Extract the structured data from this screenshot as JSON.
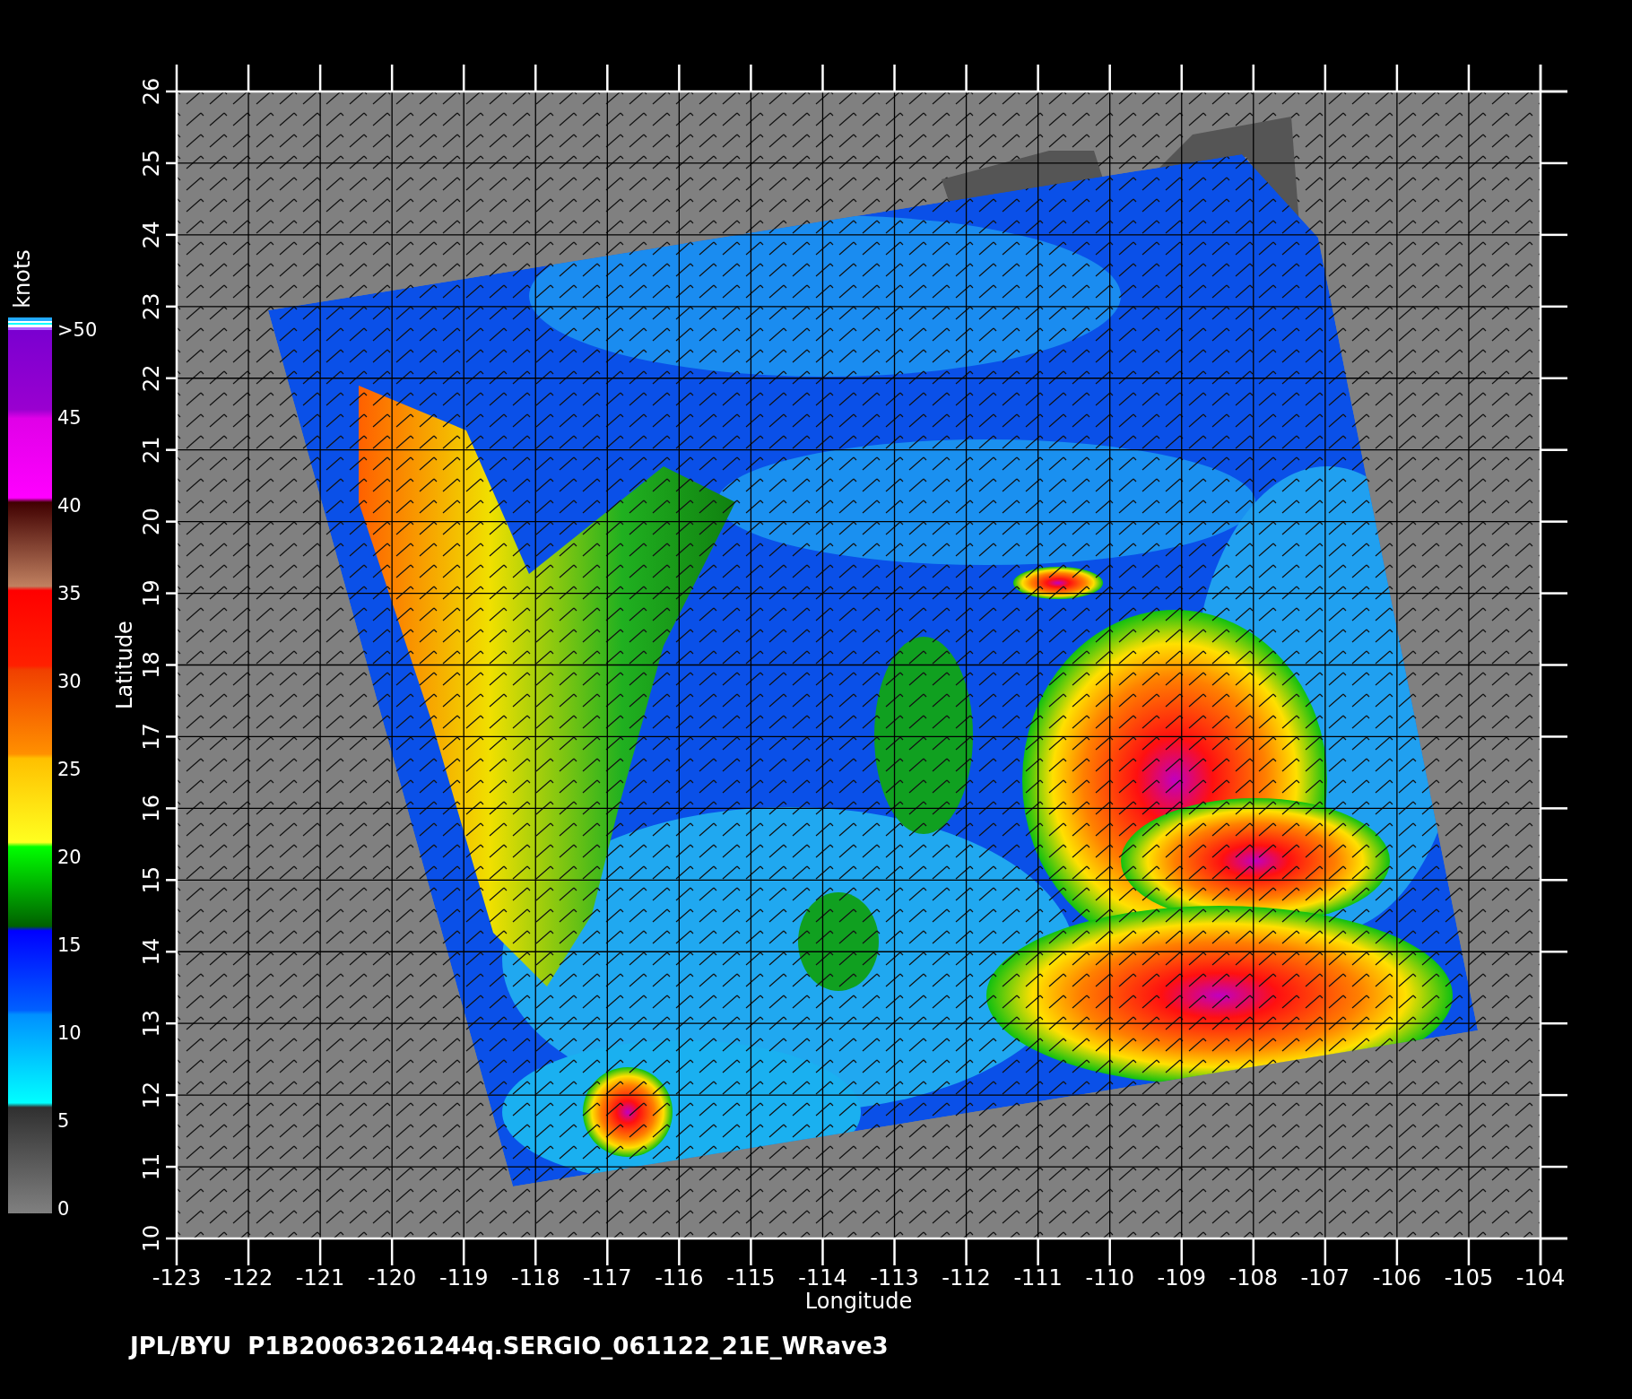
{
  "colorbar": {
    "unit": "knots",
    "labels": [
      ">50",
      "45",
      "40",
      "35",
      "30",
      "25",
      "20",
      "15",
      "10",
      "5",
      "0"
    ]
  },
  "plot": {
    "ylabel": "Latitude",
    "xlabel": "Longitude",
    "yticks": [
      "26",
      "25",
      "24",
      "23",
      "22",
      "21",
      "20",
      "19",
      "18",
      "17",
      "16",
      "15",
      "14",
      "13",
      "12",
      "11",
      "10"
    ],
    "xticks": [
      "-123",
      "-122",
      "-121",
      "-120",
      "-119",
      "-118",
      "-117",
      "-116",
      "-115",
      "-114",
      "-113",
      "-112",
      "-111",
      "-110",
      "-109",
      "-108",
      "-107",
      "-106",
      "-105",
      "-104"
    ]
  },
  "footer": "JPL/BYU  P1B20063261244q.SERGIO_061122_21E_WRave3"
}
